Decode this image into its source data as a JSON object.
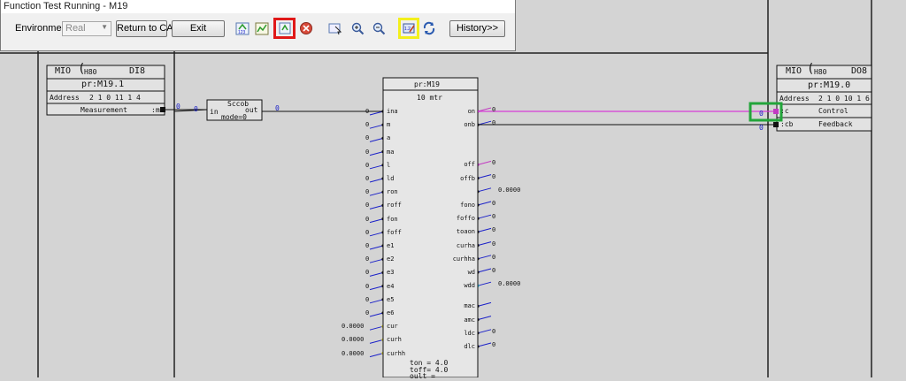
{
  "window": {
    "title": "Function Test Running - M19",
    "environment_label": "Environment:",
    "environment_value": "Real",
    "buttons": {
      "return_to_cad": "Return to CAD",
      "exit": "Exit",
      "history": "History>>"
    }
  },
  "highlight_colors": {
    "red": "#e01818",
    "yellow": "#f3ef1c",
    "green": "#22a53a"
  },
  "icons": [
    "step-icon",
    "chart-icon",
    "refresh-record-icon",
    "stop-icon",
    "pointer-icon",
    "zoom-in-icon",
    "zoom-out-icon",
    "edit-value-icon",
    "cycle-icon"
  ],
  "di_block": {
    "type": "MIO",
    "bus": "H80",
    "kind": "DI8",
    "name": "pr:M19.1",
    "address_label": "Address",
    "address": "2 1 0 11 1 4",
    "signal": "Measurement",
    "pin": ":m",
    "out_value": "0"
  },
  "scoob": {
    "name": "Sccob",
    "in_pin": "in",
    "out_pin": "out",
    "mode": "mode=0",
    "in_value": "0",
    "out_value": "0"
  },
  "motor": {
    "name": "pr:M19",
    "label": "10 mtr",
    "inputs": [
      "ina",
      "m",
      "a",
      "ma",
      "l",
      "ld",
      "ron",
      "roff",
      "fon",
      "foff",
      "e1",
      "e2",
      "e3",
      "e4",
      "e5",
      "e6",
      "cur",
      "curh",
      "curhh"
    ],
    "input_values": [
      "0",
      "0",
      "0",
      "0",
      "0",
      "0",
      "0",
      "0",
      "0",
      "0",
      "0",
      "0",
      "0",
      "0",
      "0",
      "0",
      "0.0000",
      "0.0000",
      "0.0000"
    ],
    "outputs": [
      "on",
      "onb",
      "off",
      "offb",
      "",
      "fono",
      "foffo",
      "toaon",
      "curha",
      "curhha",
      "wd",
      "wdd",
      "mac",
      "amc",
      "ldc",
      "dlc"
    ],
    "output_values": [
      "0",
      "0",
      "0",
      "0",
      "0.0000",
      "0",
      "0",
      "0",
      "0",
      "0",
      "0",
      "0.0000",
      "",
      "",
      "0",
      "0"
    ],
    "footer": [
      "ton = 4.0",
      "toff= 4.0",
      "oult ="
    ]
  },
  "do_block": {
    "type": "MIO",
    "bus": "H80",
    "kind": "DO8",
    "name": "pr:M19.0",
    "address_label": "Address",
    "address": "2 1 0 10 1 6",
    "rows": [
      {
        "pin": ":c",
        "label": "Control"
      },
      {
        "pin": ":cb",
        "label": "Feedback"
      }
    ],
    "in_values": [
      "0",
      "0"
    ]
  }
}
